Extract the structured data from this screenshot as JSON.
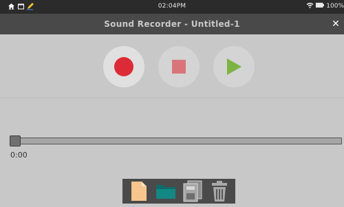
{
  "statusbar": {
    "time": "02:04PM",
    "battery": "100%"
  },
  "window": {
    "title": "Sound Recorder - Untitled-1",
    "close_label": "✕"
  },
  "controls": {
    "record": "record",
    "stop": "stop",
    "play": "play"
  },
  "playback": {
    "position_label": "0:00",
    "progress": 0.0
  },
  "toolbar": {
    "items": [
      "new-file",
      "open-folder",
      "save",
      "delete"
    ]
  },
  "colors": {
    "record": "#dc2b36",
    "stop": "#d9757a",
    "play": "#7cb342",
    "toolbar_bg": "#4a4a4a"
  }
}
